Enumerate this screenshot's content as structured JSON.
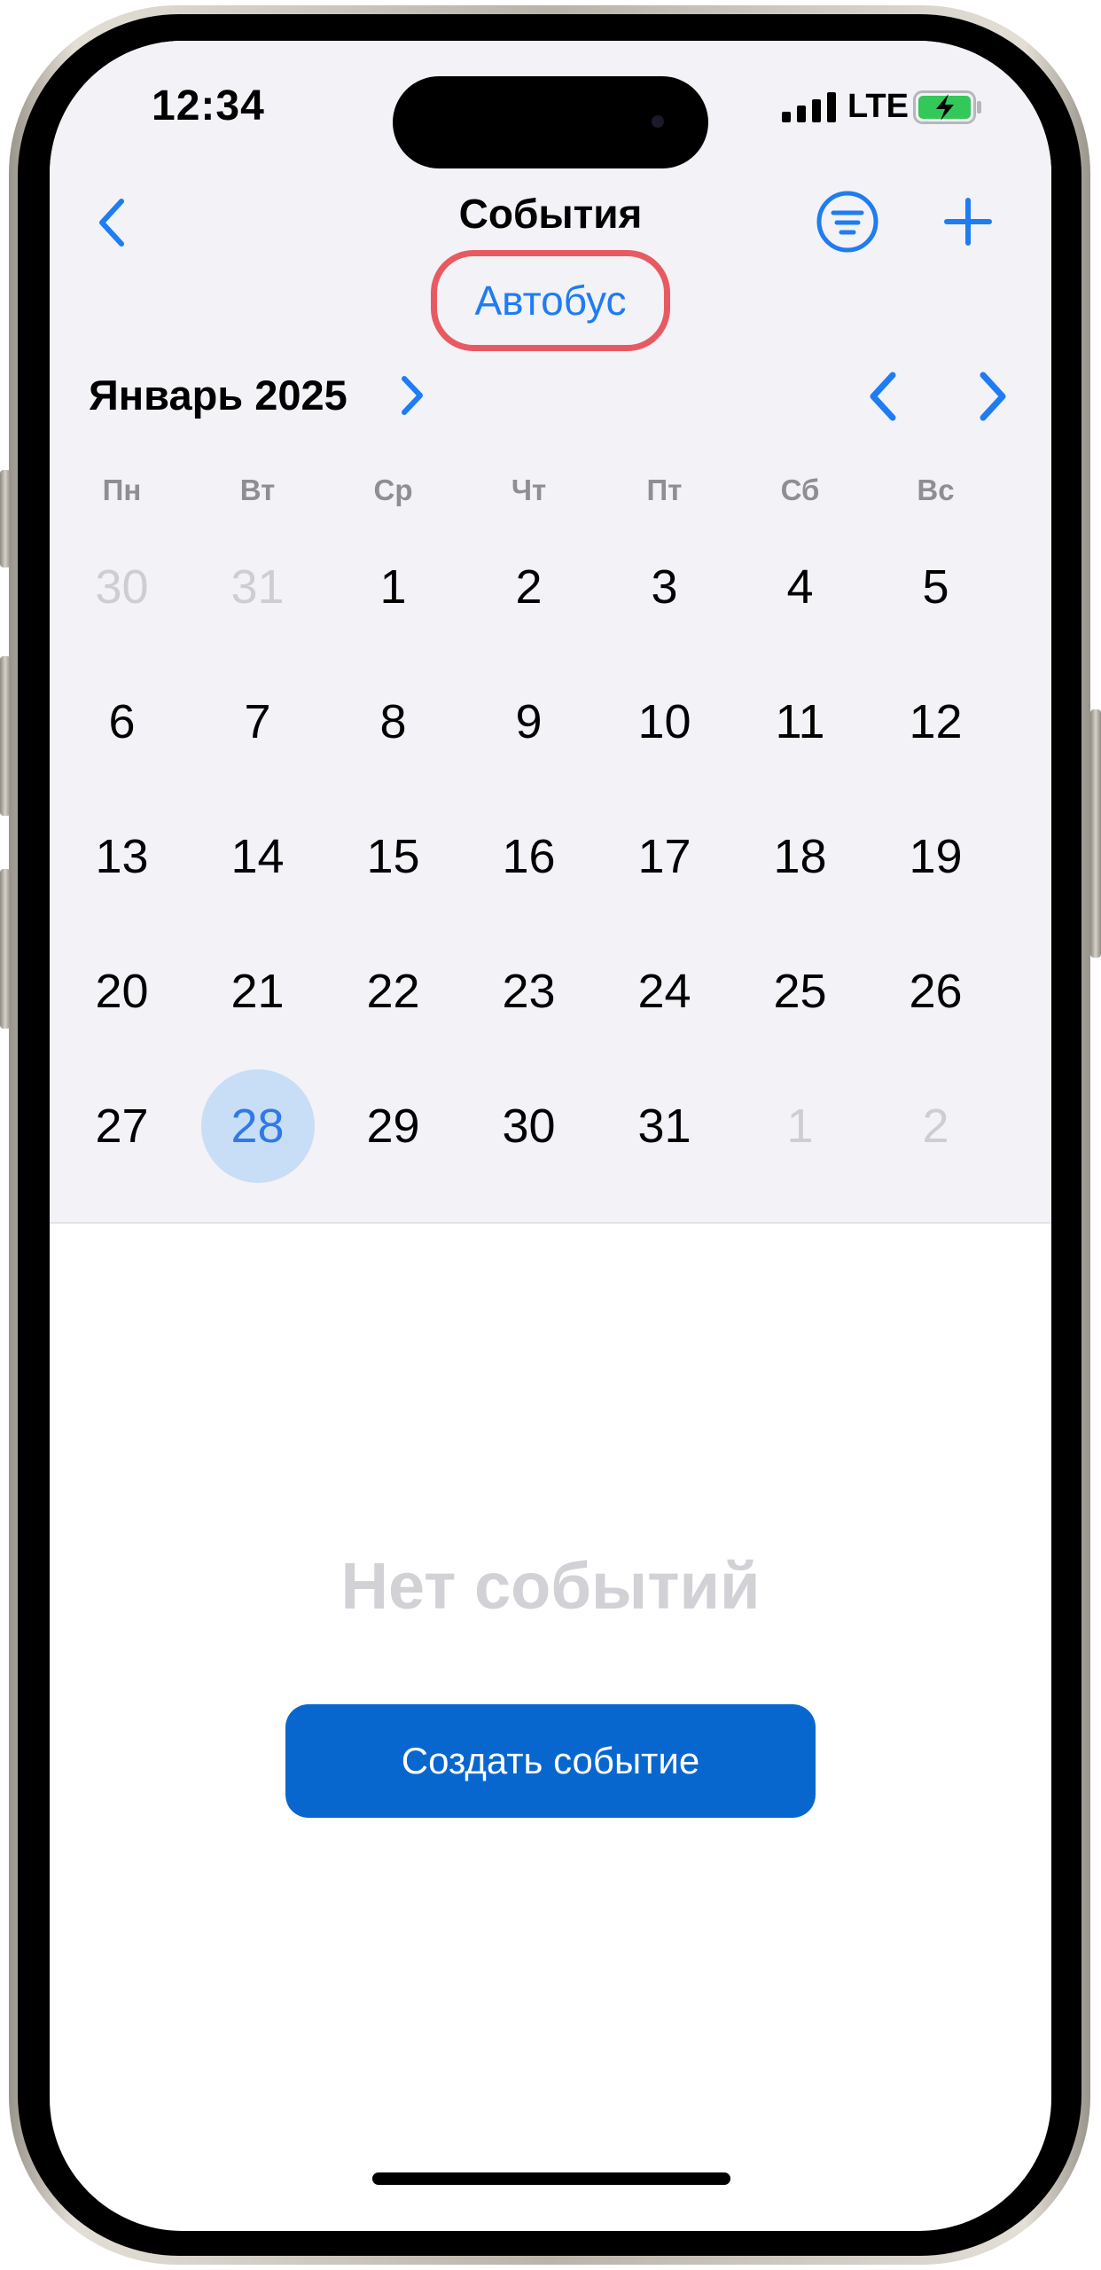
{
  "status_bar": {
    "time": "12:34",
    "network": "LTE",
    "battery_state": "charging"
  },
  "nav": {
    "title": "События",
    "back_icon": "chevron-left-icon",
    "filter_icon": "filter-lines-icon",
    "add_icon": "plus-icon"
  },
  "category": {
    "label": "Автобус"
  },
  "calendar": {
    "month_label": "Январь 2025",
    "weekdays": [
      "Пн",
      "Вт",
      "Ср",
      "Чт",
      "Пт",
      "Сб",
      "Вс"
    ],
    "weeks": [
      [
        {
          "d": "30",
          "out": true
        },
        {
          "d": "31",
          "out": true
        },
        {
          "d": "1"
        },
        {
          "d": "2"
        },
        {
          "d": "3"
        },
        {
          "d": "4"
        },
        {
          "d": "5"
        }
      ],
      [
        {
          "d": "6"
        },
        {
          "d": "7"
        },
        {
          "d": "8"
        },
        {
          "d": "9"
        },
        {
          "d": "10"
        },
        {
          "d": "11"
        },
        {
          "d": "12"
        }
      ],
      [
        {
          "d": "13"
        },
        {
          "d": "14"
        },
        {
          "d": "15"
        },
        {
          "d": "16"
        },
        {
          "d": "17"
        },
        {
          "d": "18"
        },
        {
          "d": "19"
        }
      ],
      [
        {
          "d": "20"
        },
        {
          "d": "21"
        },
        {
          "d": "22"
        },
        {
          "d": "23"
        },
        {
          "d": "24"
        },
        {
          "d": "25"
        },
        {
          "d": "26"
        }
      ],
      [
        {
          "d": "27"
        },
        {
          "d": "28",
          "selected": true
        },
        {
          "d": "29"
        },
        {
          "d": "30"
        },
        {
          "d": "31"
        },
        {
          "d": "1",
          "out": true
        },
        {
          "d": "2",
          "out": true
        }
      ]
    ]
  },
  "empty_state": {
    "message": "Нет событий",
    "create_button": "Создать событие"
  },
  "colors": {
    "accent": "#1f7cf2",
    "button": "#0867cf",
    "highlight_ring": "#e85a62",
    "selected_day_bg": "#c8ddf6",
    "battery_green": "#34c759"
  }
}
